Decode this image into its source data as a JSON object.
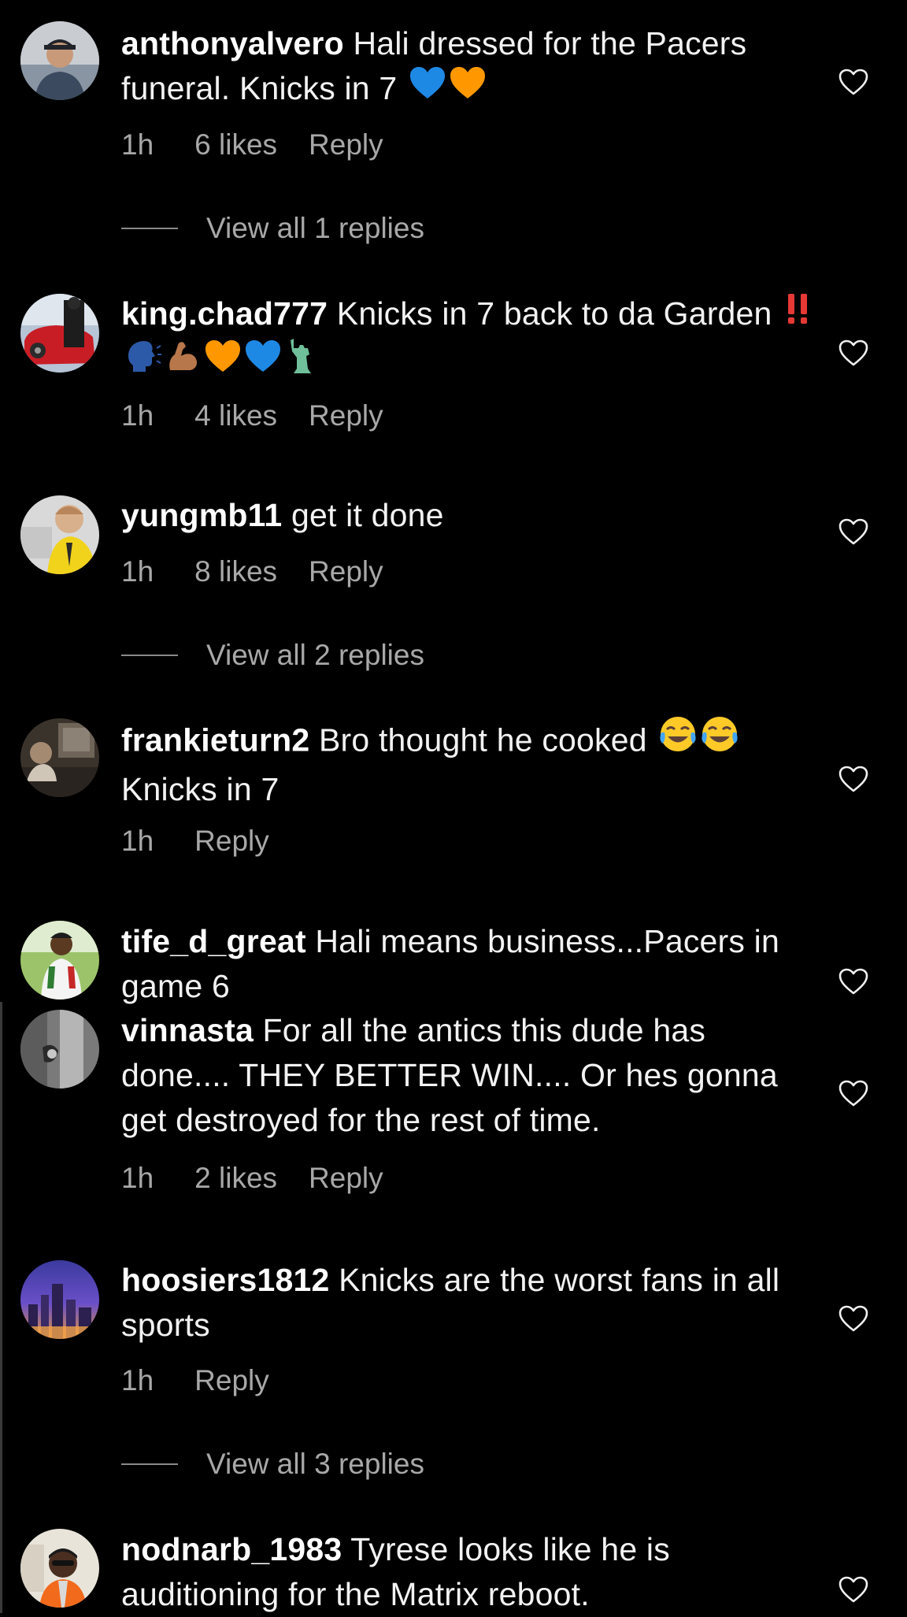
{
  "comments": [
    {
      "username": "anthonyalvero",
      "text": "Hali dressed for the Pacers funeral. Knicks in 7",
      "emojis": [
        "blue-heart",
        "orange-heart"
      ],
      "time": "1h",
      "likes": "6 likes",
      "reply": "Reply",
      "view_replies": "View all 1 replies"
    },
    {
      "username": "king.chad777",
      "text": "Knicks in 7 back to da Garden",
      "emojis": [
        "double-exclamation",
        "speaking-head",
        "flexed-biceps",
        "orange-heart",
        "blue-heart",
        "statue-of-liberty"
      ],
      "time": "1h",
      "likes": "4 likes",
      "reply": "Reply"
    },
    {
      "username": "yungmb11",
      "text": "get it done",
      "time": "1h",
      "likes": "8 likes",
      "reply": "Reply",
      "view_replies": "View all 2 replies"
    },
    {
      "username": "frankieturn2",
      "text": "Bro thought he cooked",
      "text_after": "Knicks in 7",
      "emojis": [
        "tears-of-joy",
        "tears-of-joy"
      ],
      "time": "1h",
      "reply": "Reply"
    },
    {
      "username": "tife_d_great",
      "text": "Hali means business...Pacers in game 6"
    },
    {
      "username": "vinnasta",
      "text": "For all the antics this dude has done.... THEY BETTER WIN.... Or hes gonna get destroyed for the rest of time.",
      "time": "1h",
      "likes": "2 likes",
      "reply": "Reply"
    },
    {
      "username": "hoosiers1812",
      "text": "Knicks are the worst fans in all sports",
      "time": "1h",
      "reply": "Reply",
      "view_replies": "View all 3 replies"
    },
    {
      "username": "nodnarb_1983",
      "text": "Tyrese looks like he is auditioning for the Matrix reboot."
    }
  ],
  "icons": {
    "like": "heart-outline-icon"
  },
  "colors": {
    "background": "#000000",
    "text": "#f2f2f2",
    "meta": "#a8a8a8"
  }
}
